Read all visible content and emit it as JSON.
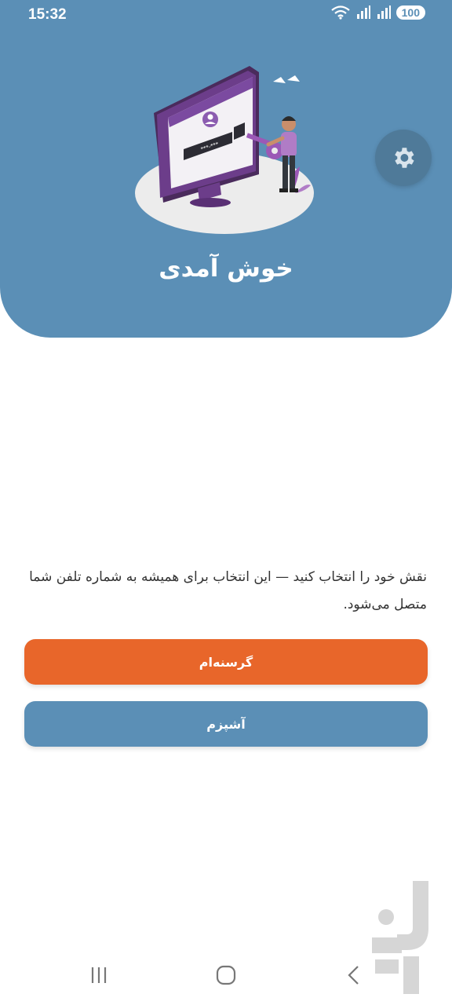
{
  "status_bar": {
    "time": "15:32",
    "battery": "100",
    "icons": [
      "wifi-icon",
      "signal-icon",
      "signal-icon",
      "battery-icon"
    ]
  },
  "header": {
    "title": "خوش آمدی",
    "illustration_icon": "computer-login-key-illustration",
    "illustration_password_text": "***-***",
    "settings_icon": "gear-icon"
  },
  "main": {
    "description": "نقش خود را انتخاب کنید — این انتخاب برای همیشه به شماره تلفن شما متصل می‌شود.",
    "hungry_label": "گرسنه‌ام",
    "chef_label": "آشپزم"
  },
  "nav": {
    "icons": [
      "recent-apps-icon",
      "home-icon",
      "back-icon"
    ]
  },
  "colors": {
    "header": "#5b8fb6",
    "primary_button": "#e8662a",
    "secondary_button": "#5b8fb6",
    "settings_button": "#4f7a99"
  }
}
